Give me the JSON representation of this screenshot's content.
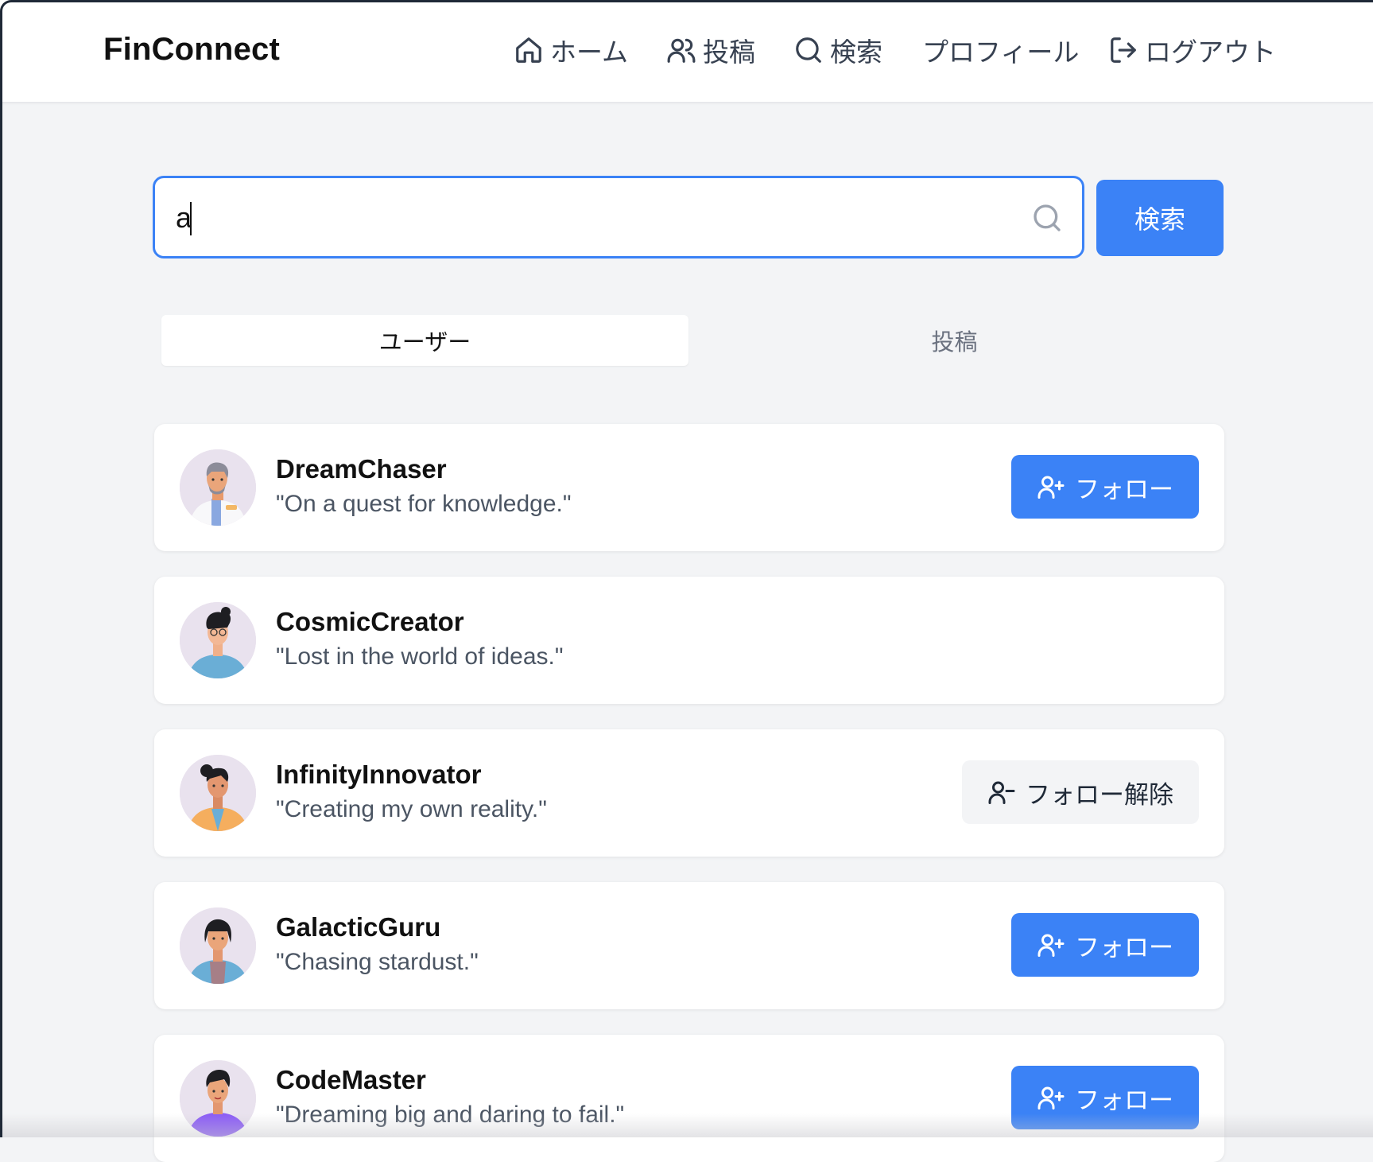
{
  "header": {
    "brand": "FinConnect",
    "nav": [
      {
        "label": "ホーム",
        "icon": "home-icon"
      },
      {
        "label": "投稿",
        "icon": "users-icon"
      },
      {
        "label": "検索",
        "icon": "search-icon"
      },
      {
        "label": "プロフィール",
        "icon": ""
      },
      {
        "label": "ログアウト",
        "icon": "logout-icon"
      }
    ]
  },
  "search": {
    "value": "a",
    "placeholder": "",
    "button_label": "検索"
  },
  "tabs": {
    "users": "ユーザー",
    "posts": "投稿",
    "active": "users"
  },
  "results": [
    {
      "username": "DreamChaser",
      "bio": "\"On a quest for knowledge.\"",
      "action": "フォロー",
      "action_type": "follow"
    },
    {
      "username": "CosmicCreator",
      "bio": "\"Lost in the world of ideas.\"",
      "action": "",
      "action_type": "none"
    },
    {
      "username": "InfinityInnovator",
      "bio": "\"Creating my own reality.\"",
      "action": "フォロー解除",
      "action_type": "unfollow"
    },
    {
      "username": "GalacticGuru",
      "bio": "\"Chasing stardust.\"",
      "action": "フォロー",
      "action_type": "follow"
    },
    {
      "username": "CodeMaster",
      "bio": "\"Dreaming big and daring to fail.\"",
      "action": "フォロー",
      "action_type": "follow"
    }
  ],
  "colors": {
    "primary": "#3b82f6",
    "background": "#f3f4f6",
    "card": "#ffffff"
  }
}
